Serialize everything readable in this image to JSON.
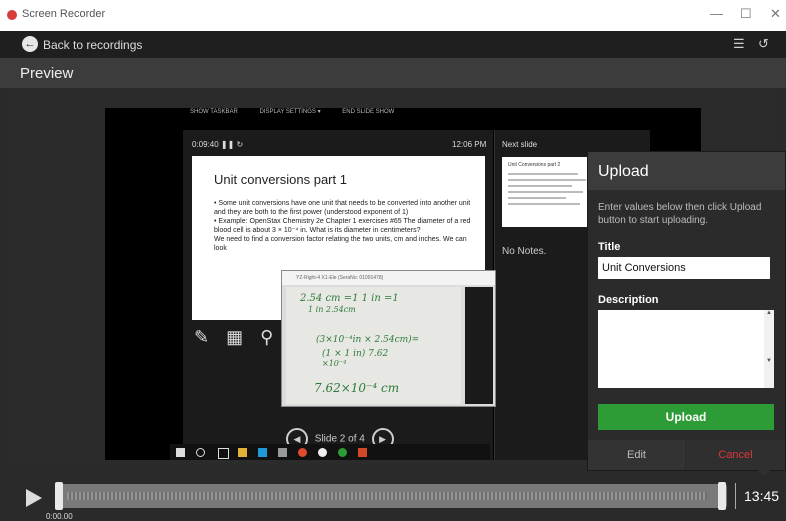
{
  "window": {
    "title": "Screen Recorder",
    "minimize": "—",
    "maximize": "☐",
    "close": "✕"
  },
  "nav": {
    "back_label": "Back to recordings",
    "back_icon": "arrow-left-icon",
    "icons": [
      "list-icon",
      "history-icon"
    ]
  },
  "preview": {
    "label": "Preview"
  },
  "video": {
    "toolbar": [
      "SHOW TASKBAR",
      "DISPLAY SETTINGS ▾",
      "END SLIDE SHOW"
    ],
    "timer": "0:09:40  ❚❚  ↻",
    "clock": "12:06 PM",
    "slide": {
      "title": "Unit conversions part 1",
      "bullets": [
        "• Some unit conversions have one unit that needs to be converted into another unit and they are both to the first power (understood exponent of 1)",
        "• Example: OpenStax Chemistry 2e Chapter 1 exercises #65 The diameter of a red blood cell is about 3 × 10⁻⁴ in. What is its diameter in centimeters?"
      ],
      "text": "We need to find a conversion factor relating the two units, cm and inches.  We can look"
    },
    "next_slide_label": "Next slide",
    "next_slide_title": "Unit Conversions part 2",
    "notes": "No Notes.",
    "slide_counter": "Slide 2 of 4",
    "webcam": {
      "title": "YZ-Right-4 X1-Ele (SeraNo: 01091478)",
      "lines": [
        "2.54 cm  =1   1 in  =1",
        "1 in        2.54cm",
        "(3×10⁻⁴in × 2.54cm)=",
        "(1 × 1 in)    7.62",
        "                       ×10⁻⁴",
        "7.62×10⁻⁴ cm"
      ]
    }
  },
  "upload_panel": {
    "title": "Upload",
    "info": "Enter values below then click Upload button to start uploading.",
    "title_label": "Title",
    "title_value": "Unit Conversions",
    "description_label": "Description",
    "description_value": "",
    "upload_button": "Upload",
    "edit_button": "Edit",
    "cancel_button": "Cancel"
  },
  "timeline": {
    "current_time": "0:00.00",
    "duration": "13:45"
  },
  "colors": {
    "upload_green": "#2d9c37",
    "cancel_red": "#d93838"
  }
}
